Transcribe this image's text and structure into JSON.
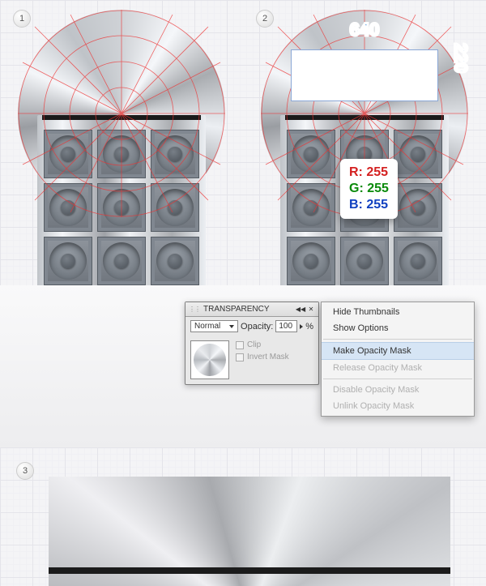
{
  "steps": {
    "one": "1",
    "two": "2",
    "three": "3"
  },
  "dims": {
    "width": "640",
    "height": "220"
  },
  "rgb": {
    "r": "R: 255",
    "g": "G: 255",
    "b": "B: 255"
  },
  "transparency": {
    "title": "TRANSPARENCY",
    "blend_mode": "Normal",
    "opacity_label": "Opacity:",
    "opacity_value": "100",
    "opacity_suffix": "%",
    "clip_label": "Clip",
    "invert_label": "Invert Mask"
  },
  "flyout": {
    "hide_thumbnails": "Hide Thumbnails",
    "show_options": "Show Options",
    "make_opacity_mask": "Make Opacity Mask",
    "release_opacity_mask": "Release Opacity Mask",
    "disable_opacity_mask": "Disable Opacity Mask",
    "unlink_opacity_mask": "Unlink Opacity Mask"
  }
}
